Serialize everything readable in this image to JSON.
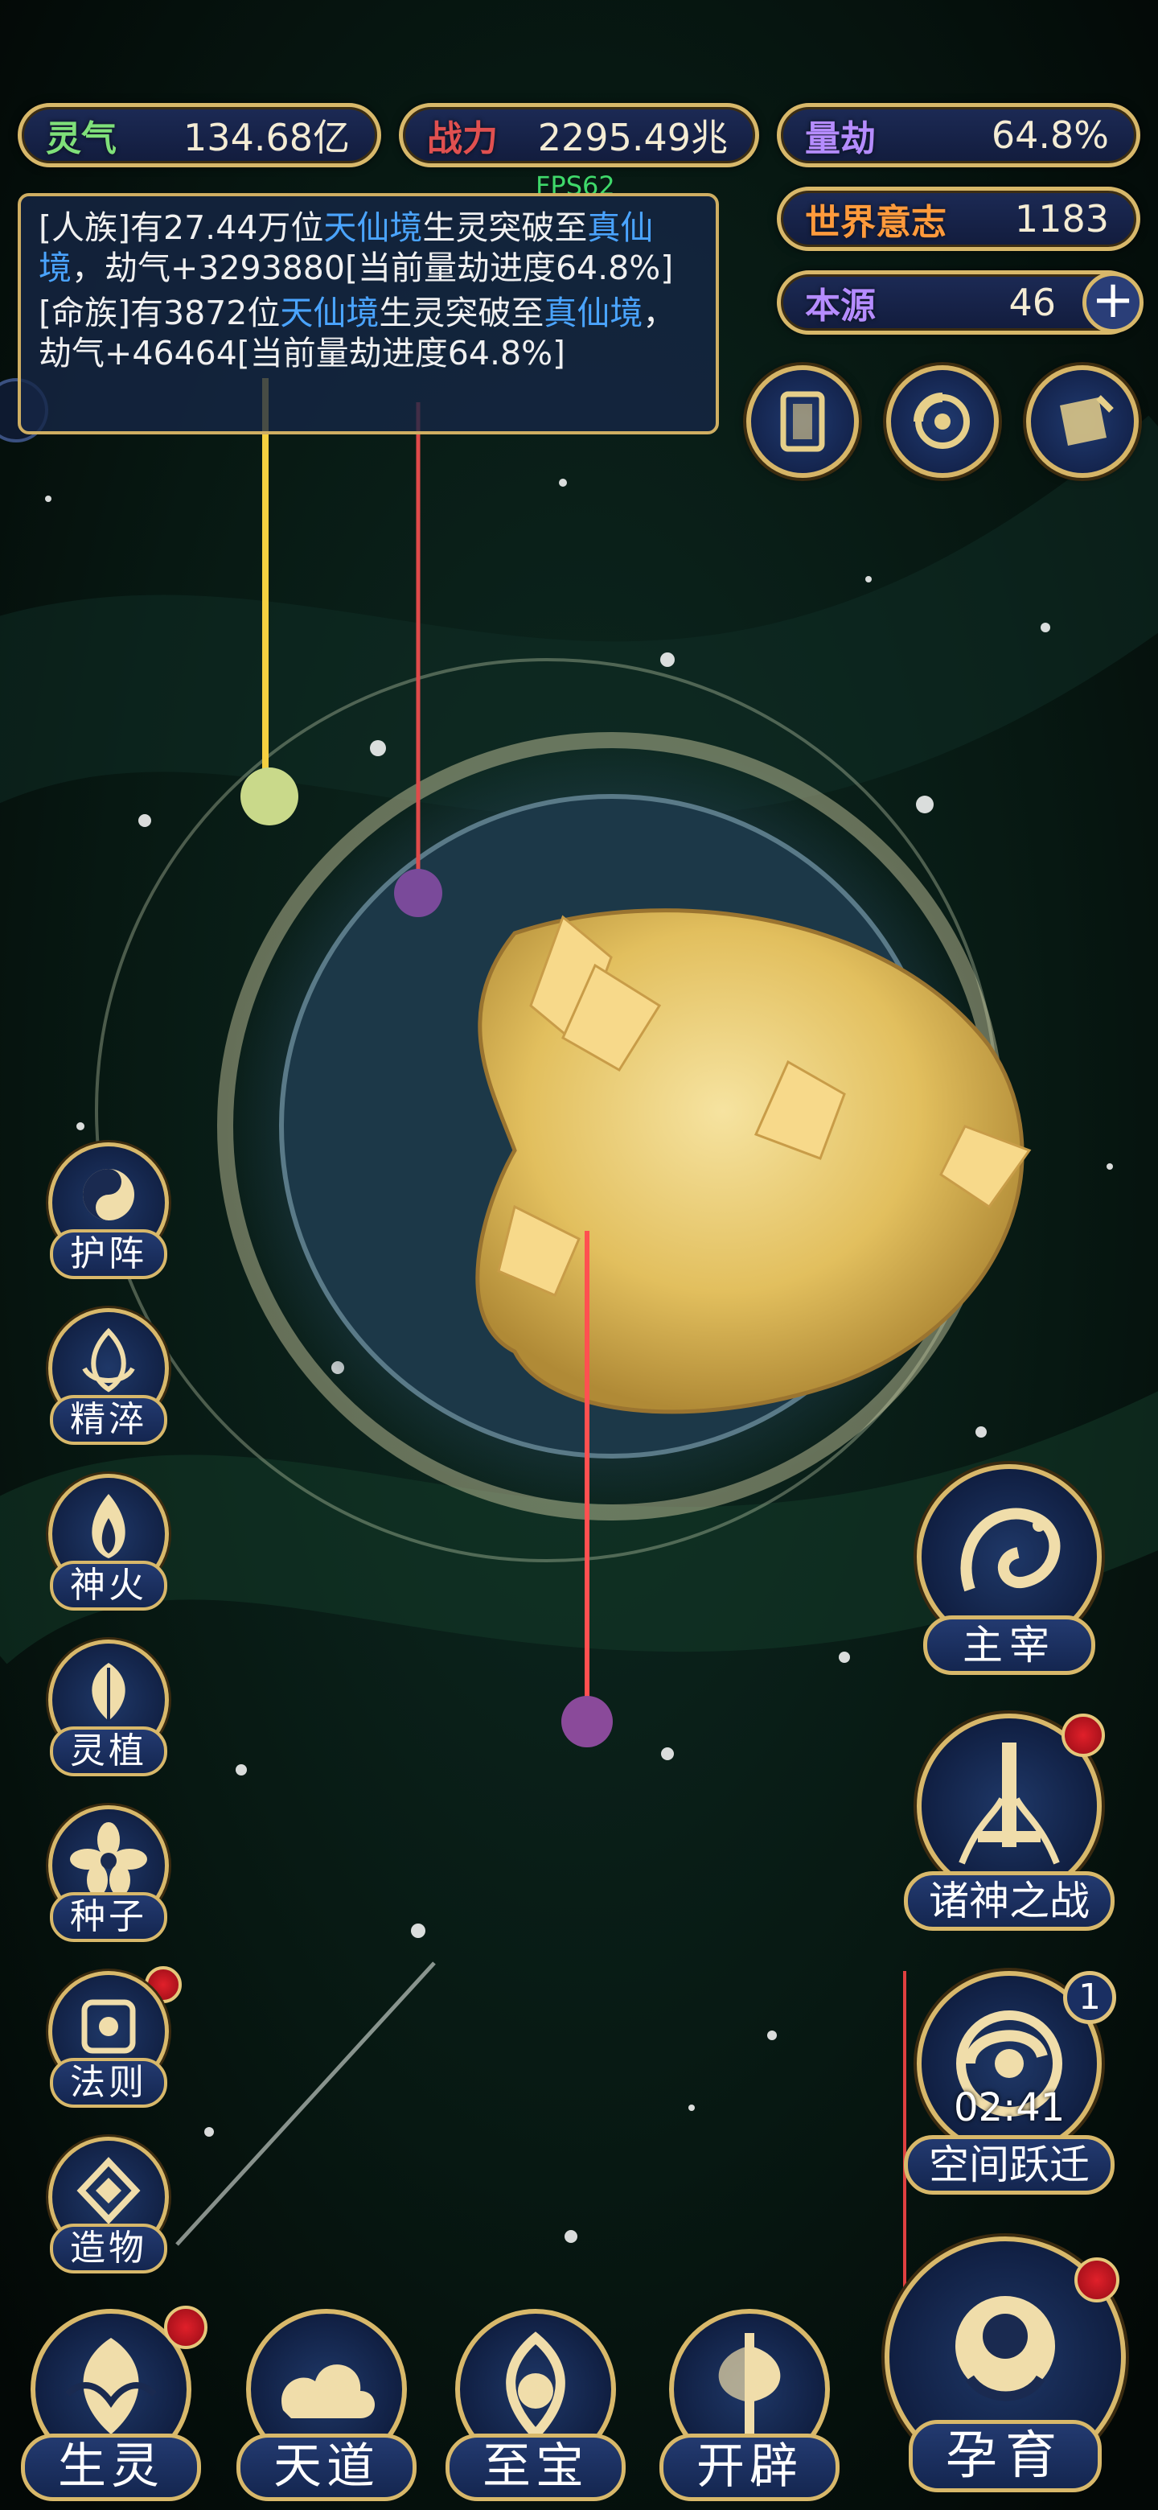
{
  "stats": {
    "lingqi": {
      "label": "灵气",
      "value": "134.68亿",
      "color": "#7fe07a"
    },
    "zhanli": {
      "label": "战力",
      "value": "2295.49兆",
      "color": "#e05050"
    },
    "liangjie": {
      "label": "量劫",
      "value": "64.8%",
      "color": "#b58cff"
    },
    "shijie": {
      "label": "世界意志",
      "value": "1183",
      "color": "#ff9a3c"
    },
    "benyuan": {
      "label": "本源",
      "value": "46",
      "color": "#b58cff"
    }
  },
  "fps": "FPS62",
  "log": {
    "entries": [
      {
        "p1": "[人族]有27.44万位",
        "h1": "天仙境",
        "p2": "生灵突破至",
        "h2": "真仙境",
        "p3": "，劫气+3293880[当前量劫进度64.8%]"
      },
      {
        "p1": "[命族]有3872位",
        "h1": "天仙境",
        "p2": "生灵突破至",
        "h2": "真仙境",
        "p3": "，劫气+46464[当前量劫进度64.8%]"
      }
    ]
  },
  "top_icons": [
    "card-icon",
    "vortex-icon",
    "scroll-icon"
  ],
  "left_menu": [
    {
      "label": "护阵",
      "icon": "yin-yang-icon",
      "badge": false
    },
    {
      "label": "精淬",
      "icon": "lotus-flame-icon",
      "badge": false
    },
    {
      "label": "神火",
      "icon": "fire-icon",
      "badge": false
    },
    {
      "label": "灵植",
      "icon": "leaf-icon",
      "badge": false
    },
    {
      "label": "种子",
      "icon": "flower-icon",
      "badge": true
    },
    {
      "label": "法则",
      "icon": "rune-icon",
      "badge": true
    },
    {
      "label": "造物",
      "icon": "diamond-icon",
      "badge": false
    }
  ],
  "right_menu": {
    "zhuzai": {
      "label": "主宰",
      "icon": "dragon-icon"
    },
    "zhushen": {
      "label": "诸神之战",
      "icon": "sword-icon",
      "badge": true
    },
    "kongjian": {
      "label": "空间跃迁",
      "icon": "swirl-icon",
      "timer": "02:41",
      "count": "1"
    }
  },
  "bottom_menu": [
    {
      "label": "生灵",
      "icon": "phoenix-icon",
      "badge": true
    },
    {
      "label": "天道",
      "icon": "cloud-icon",
      "badge": false
    },
    {
      "label": "至宝",
      "icon": "treasure-icon",
      "badge": false
    },
    {
      "label": "开辟",
      "icon": "axe-icon",
      "badge": false
    }
  ],
  "yunyu": {
    "label": "孕育",
    "icon": "embryo-icon",
    "badge": true
  },
  "colors": {
    "gold": "#d8b86a",
    "panel": "#16264a",
    "highlight": "#4aa4ff"
  }
}
